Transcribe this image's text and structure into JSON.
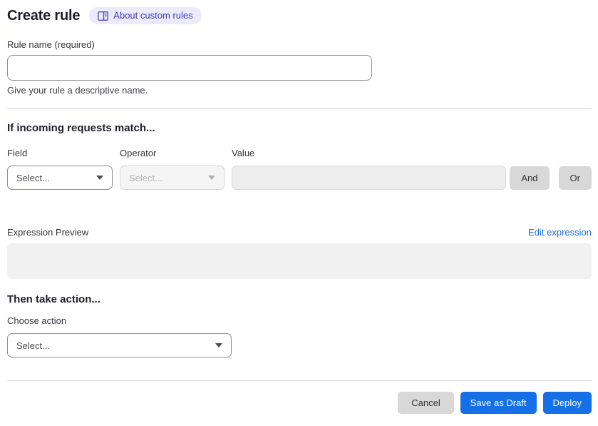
{
  "header": {
    "title": "Create rule",
    "about_badge": {
      "label": "About custom rules",
      "icon": "book-reader-icon"
    }
  },
  "rule_name": {
    "label": "Rule name (required)",
    "value": "",
    "helper": "Give your rule a descriptive name."
  },
  "match_section": {
    "heading": "If incoming requests match...",
    "field": {
      "label": "Field",
      "selected": "Select...",
      "enabled": true
    },
    "operator": {
      "label": "Operator",
      "selected": "Select...",
      "enabled": false
    },
    "value": {
      "label": "Value",
      "value": "",
      "enabled": false
    },
    "and_button": "And",
    "or_button": "Or"
  },
  "expression": {
    "label": "Expression Preview",
    "edit_link": "Edit expression",
    "content": ""
  },
  "action_section": {
    "heading": "Then take action...",
    "choose_label": "Choose action",
    "selected": "Select..."
  },
  "footer": {
    "cancel": "Cancel",
    "save_draft": "Save as Draft",
    "deploy": "Deploy"
  },
  "colors": {
    "primary_blue": "#1570e8",
    "link_blue": "#1a6fe0",
    "badge_bg": "#eceafb",
    "badge_text": "#3d3cc0",
    "gray_button": "#d8d8d9",
    "disabled_bg": "#f5f5f6",
    "preview_bg": "#f1f1f2"
  }
}
